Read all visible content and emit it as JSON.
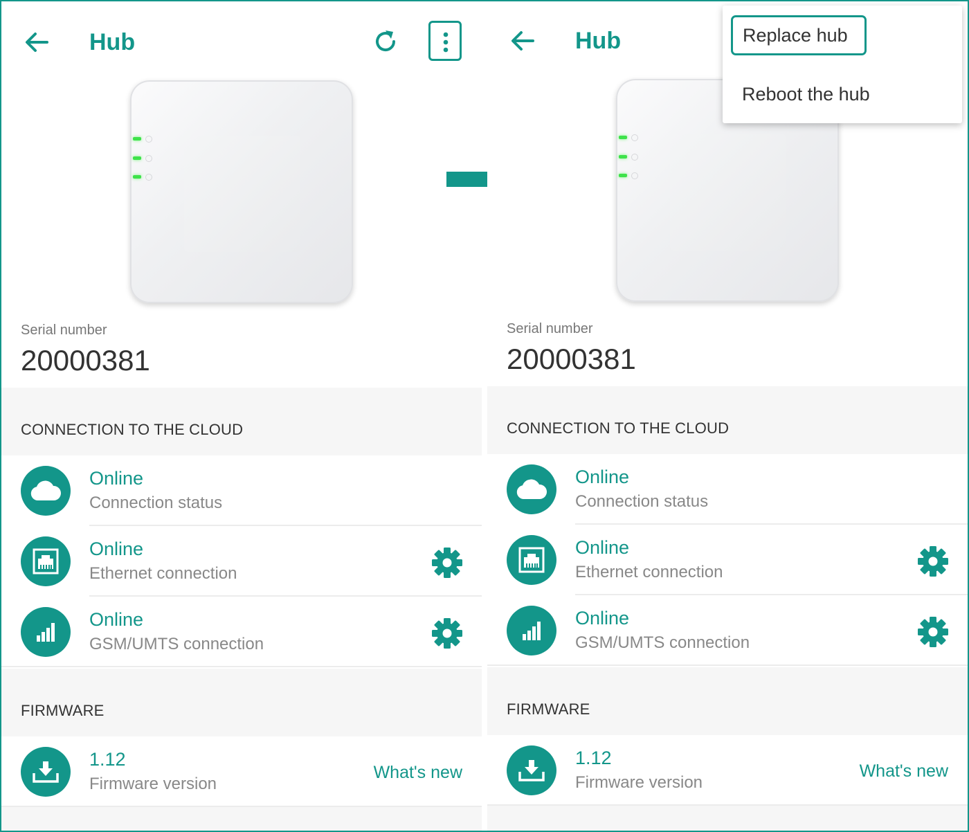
{
  "colors": {
    "accent": "#13968a",
    "led_green": "#3ee24a",
    "section_bg": "#f6f6f6"
  },
  "panels": [
    {
      "title": "Hub",
      "serial_label": "Serial number",
      "serial_value": "20000381",
      "cloud_header": "CONNECTION TO THE CLOUD",
      "rows": [
        {
          "status": "Online",
          "label": "Connection status",
          "icon": "cloud-icon"
        },
        {
          "status": "Online",
          "label": "Ethernet connection",
          "icon": "ethernet-icon",
          "settings": true
        },
        {
          "status": "Online",
          "label": "GSM/UMTS connection",
          "icon": "signal-bars-icon",
          "settings": true
        }
      ],
      "firmware_header": "FIRMWARE",
      "firmware": {
        "version": "1.12",
        "label": "Firmware version",
        "link": "What's new",
        "icon": "download-icon"
      }
    },
    {
      "title": "Hub",
      "serial_label": "Serial number",
      "serial_value": "20000381",
      "cloud_header": "CONNECTION TO THE CLOUD",
      "rows": [
        {
          "status": "Online",
          "label": "Connection status",
          "icon": "cloud-icon"
        },
        {
          "status": "Online",
          "label": "Ethernet connection",
          "icon": "ethernet-icon",
          "settings": true
        },
        {
          "status": "Online",
          "label": "GSM/UMTS connection",
          "icon": "signal-bars-icon",
          "settings": true
        }
      ],
      "firmware_header": "FIRMWARE",
      "firmware": {
        "version": "1.12",
        "label": "Firmware version",
        "link": "What's new",
        "icon": "download-icon"
      }
    }
  ],
  "menu": {
    "items": [
      "Replace hub",
      "Reboot the hub"
    ],
    "highlighted": "Replace hub"
  }
}
